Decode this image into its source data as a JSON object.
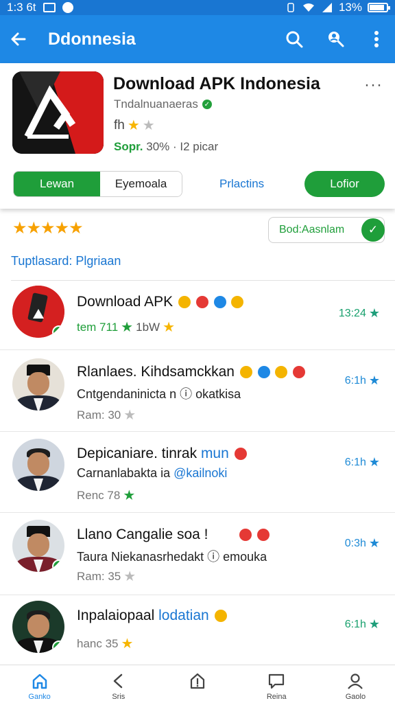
{
  "status_bar": {
    "time": "1:3 6t",
    "battery": "13%"
  },
  "app_bar": {
    "title": "Ddonnesia",
    "icons": [
      "back-arrow-icon",
      "search-icon",
      "account-search-icon",
      "more-vert-icon"
    ]
  },
  "app_card": {
    "name": "Download APK Indonesia",
    "developer": "Tndalnuanaeras",
    "rating_prefix": "fh",
    "stats_highlight": "Sopr.",
    "stats_rest": "30% · I2 picar",
    "segment_left": "Lewan",
    "segment_right": "Eyemoala",
    "link_button": "Prlactins",
    "install_button": "Lofior",
    "more": "···"
  },
  "rating_section": {
    "stars": "★★★★★",
    "verified_label": "Bod:Aasnlam",
    "section_link": "Tuptlasard: Plgriaan"
  },
  "rows": [
    {
      "title": "Download APK",
      "title_blue": "",
      "subtitle": "",
      "meta": "tem 711",
      "meta2": "1bW",
      "time": "13:24",
      "verified": true
    },
    {
      "title": "Rlanlaes. Kihdsamckkan",
      "title_blue": "",
      "subtitle": "Cntgendaninicta n",
      "subtitle_blue": "",
      "subtitle_tail": "okatkisa",
      "meta": "Ram: 30",
      "time": "6:1h",
      "verified": false
    },
    {
      "title": "Depicaniare. tinrak",
      "title_blue": "mun",
      "subtitle": "Carnanlabakta ia",
      "subtitle_blue": "@kailnoki",
      "subtitle_tail": "",
      "meta": "Renc 78",
      "time": "6:1h",
      "verified": false
    },
    {
      "title": "Llano Cangalie soa !",
      "title_blue": "",
      "subtitle": "Taura Niekanasrhedakt",
      "subtitle_blue": "",
      "subtitle_tail": "emouka",
      "meta": "Ram: 35",
      "time": "0:3h",
      "verified": true
    },
    {
      "title": "Inpalaiopaal",
      "title_blue": "lodatian",
      "subtitle": "",
      "meta": "hanc 35",
      "time": "6:1h",
      "verified": true
    }
  ],
  "bottom_nav": [
    {
      "label": "Ganko",
      "icon": "home-icon"
    },
    {
      "label": "Sris",
      "icon": "back-chevron-icon"
    },
    {
      "label": "",
      "icon": "upload-icon"
    },
    {
      "label": "Reina",
      "icon": "chat-icon"
    },
    {
      "label": "Gaolo",
      "icon": "person-icon"
    }
  ],
  "colors": {
    "app_bar": "#1e88e5",
    "status_bar": "#1976d2",
    "accent_green": "#1f9e3a",
    "link_blue": "#1976d2"
  }
}
